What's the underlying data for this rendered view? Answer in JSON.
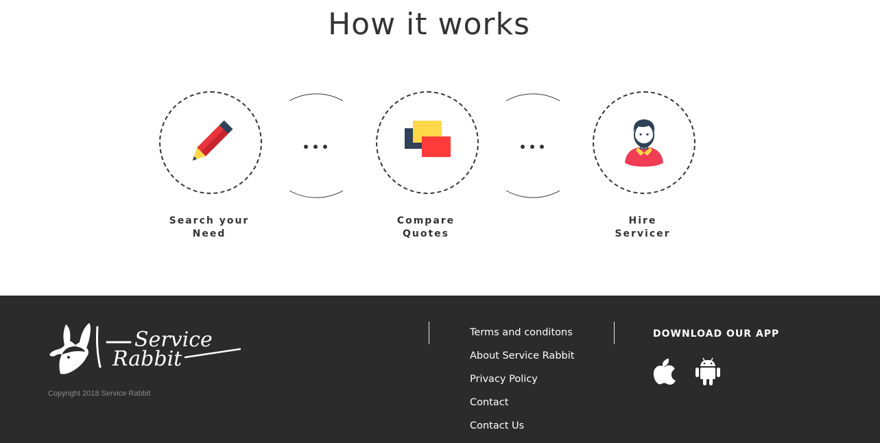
{
  "how_it_works": {
    "title": "How it works",
    "steps": [
      {
        "label_line1": "Search your",
        "label_line2": "Need",
        "icon": "pencil-icon"
      },
      {
        "label_line1": "Compare",
        "label_line2": "Quotes",
        "icon": "compare-quotes-icon"
      },
      {
        "label_line1": "Hire",
        "label_line2": "Servicer",
        "icon": "servicer-avatar-icon"
      }
    ],
    "connector_icon": "ellipsis-icon"
  },
  "footer": {
    "logo_text": "Service Rabbit",
    "copyright": "Copyright 2018 Service Rabbit",
    "links": [
      "Terms and conditons",
      "About Service Rabbit",
      "Privacy Policy",
      "Contact",
      "Contact Us"
    ],
    "download_title": "DOWNLOAD OUR APP",
    "app_icons": [
      "apple-icon",
      "android-icon"
    ]
  },
  "colors": {
    "footer_bg": "#2b2b2b",
    "text_dark": "#333333",
    "pencil_red": "#e8343c",
    "quote_yellow": "#ffd84a",
    "quote_red": "#ff3b3b",
    "quote_navy": "#2f4157",
    "shirt_red": "#f03c55"
  }
}
